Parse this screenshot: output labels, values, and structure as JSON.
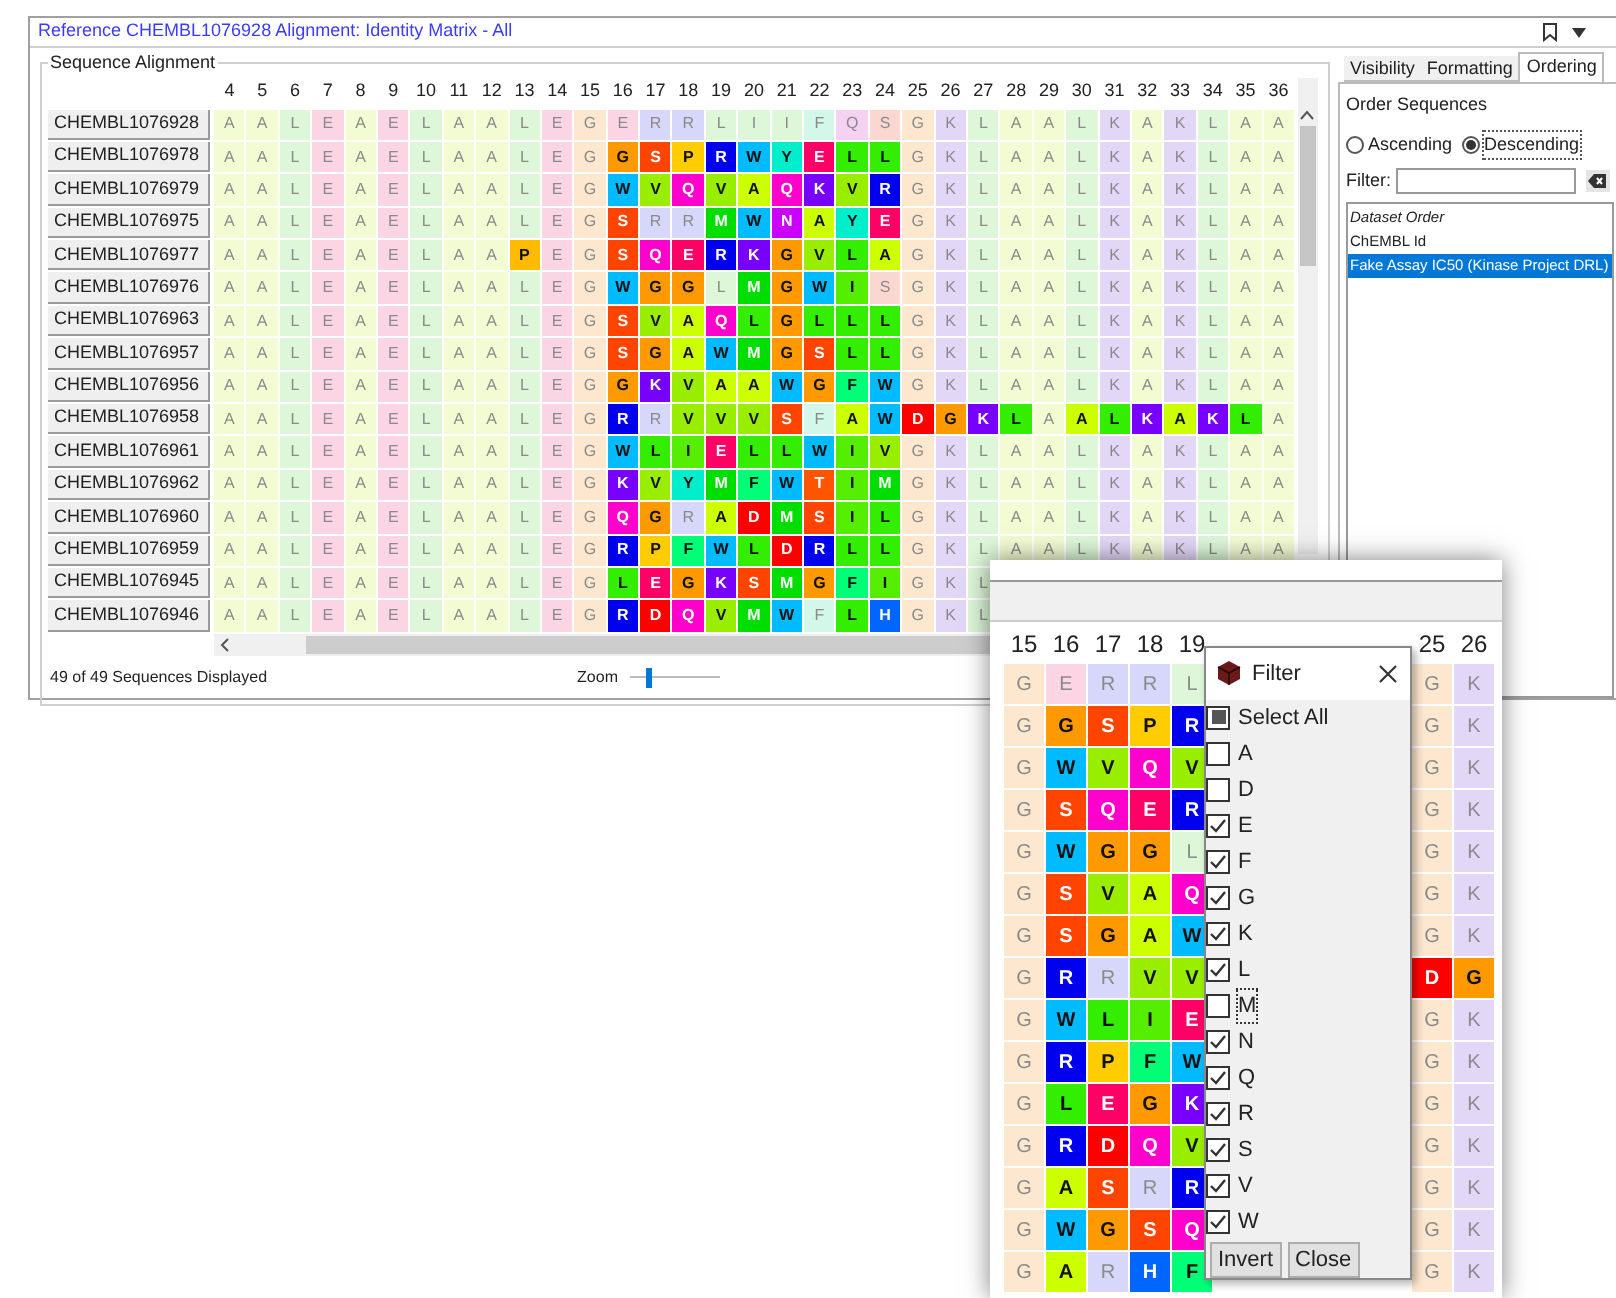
{
  "window": {
    "title": "Reference CHEMBL1076928 Alignment: Identity Matrix - All"
  },
  "alignment": {
    "title": "Sequence Alignment",
    "columns": [
      {
        "label": "4",
        "color": "#f3fbd3"
      },
      {
        "label": "5",
        "color": "#f3fbd3"
      },
      {
        "label": "6",
        "color": "#ddf7d8"
      },
      {
        "label": "7",
        "color": "#fbd5e3"
      },
      {
        "label": "8",
        "color": "#f3fbd3"
      },
      {
        "label": "9",
        "color": "#fbd5e3"
      },
      {
        "label": "10",
        "color": "#ddf7d8"
      },
      {
        "label": "11",
        "color": "#f3fbd3"
      },
      {
        "label": "12",
        "color": "#f3fbd3"
      },
      {
        "label": "13",
        "color": "#ddf7d8"
      },
      {
        "label": "14",
        "color": "#fbd5e3"
      },
      {
        "label": "15",
        "color": "#fde7cf"
      },
      {
        "label": "16",
        "color": "#fbd5e3"
      },
      {
        "label": "17",
        "color": "#d7d7fb"
      },
      {
        "label": "18",
        "color": "#d7d7fb"
      },
      {
        "label": "19",
        "color": "#ddf7d8"
      },
      {
        "label": "20",
        "color": "#ddf7d8"
      },
      {
        "label": "21",
        "color": "#ddf7d8"
      },
      {
        "label": "22",
        "color": "#d3f7e8"
      },
      {
        "label": "23",
        "color": "#f6d2f2"
      },
      {
        "label": "24",
        "color": "#fbd7d2"
      },
      {
        "label": "25",
        "color": "#fde7cf"
      },
      {
        "label": "26",
        "color": "#e3d7f8"
      },
      {
        "label": "27",
        "color": "#ddf7d8"
      },
      {
        "label": "28",
        "color": "#f3fbd3"
      },
      {
        "label": "29",
        "color": "#f3fbd3"
      },
      {
        "label": "30",
        "color": "#ddf7d8"
      },
      {
        "label": "31",
        "color": "#e3d7f8"
      },
      {
        "label": "32",
        "color": "#f3fbd3"
      },
      {
        "label": "33",
        "color": "#e3d7f8"
      },
      {
        "label": "34",
        "color": "#ddf7d8"
      },
      {
        "label": "35",
        "color": "#f3fbd3"
      },
      {
        "label": "36",
        "color": "#f3fbd3"
      }
    ],
    "rows": [
      {
        "name": "CHEMBL1076928",
        "cells": [
          "A",
          "A",
          "L",
          "E",
          "A",
          "E",
          "L",
          "A",
          "A",
          "L",
          "E",
          "G",
          "E",
          "R",
          "R",
          "L",
          "I",
          "I",
          "F",
          "Q",
          "S",
          "G",
          "K",
          "L",
          "A",
          "A",
          "L",
          "K",
          "A",
          "K",
          "L",
          "A",
          "A"
        ]
      },
      {
        "name": "CHEMBL1076978",
        "cells": [
          "A",
          "A",
          "L",
          "E",
          "A",
          "E",
          "L",
          "A",
          "A",
          "L",
          "E",
          "G",
          {
            "aa": "G",
            "color": "#ff9900"
          },
          {
            "aa": "S",
            "color": "#ff4400"
          },
          {
            "aa": "P",
            "color": "#ffcc00"
          },
          {
            "aa": "R",
            "color": "#0000ee"
          },
          {
            "aa": "W",
            "color": "#00bbff"
          },
          {
            "aa": "Y",
            "color": "#00eecc"
          },
          {
            "aa": "E",
            "color": "#ff0066"
          },
          {
            "aa": "L",
            "color": "#33ee00"
          },
          {
            "aa": "L",
            "color": "#33ee00"
          },
          "G",
          "K",
          "L",
          "A",
          "A",
          "L",
          "K",
          "A",
          "K",
          "L",
          "A",
          "A"
        ]
      },
      {
        "name": "CHEMBL1076979",
        "cells": [
          "A",
          "A",
          "L",
          "E",
          "A",
          "E",
          "L",
          "A",
          "A",
          "L",
          "E",
          "G",
          {
            "aa": "W",
            "color": "#00bbff"
          },
          {
            "aa": "V",
            "color": "#99ee00"
          },
          {
            "aa": "Q",
            "color": "#ff00cc"
          },
          {
            "aa": "V",
            "color": "#99ee00"
          },
          {
            "aa": "A",
            "color": "#ccff00"
          },
          {
            "aa": "Q",
            "color": "#ff00cc"
          },
          {
            "aa": "K",
            "color": "#7700ff"
          },
          {
            "aa": "V",
            "color": "#99ee00"
          },
          {
            "aa": "R",
            "color": "#0000ee"
          },
          "G",
          "K",
          "L",
          "A",
          "A",
          "L",
          "K",
          "A",
          "K",
          "L",
          "A",
          "A"
        ]
      },
      {
        "name": "CHEMBL1076975",
        "cells": [
          "A",
          "A",
          "L",
          "E",
          "A",
          "E",
          "L",
          "A",
          "A",
          "L",
          "E",
          "G",
          {
            "aa": "S",
            "color": "#ff4400"
          },
          "R",
          "R",
          {
            "aa": "M",
            "color": "#00dd00"
          },
          {
            "aa": "W",
            "color": "#00bbff"
          },
          {
            "aa": "N",
            "color": "#cc00ff"
          },
          {
            "aa": "A",
            "color": "#ccff00"
          },
          {
            "aa": "Y",
            "color": "#00eecc"
          },
          {
            "aa": "E",
            "color": "#ff0066"
          },
          "G",
          "K",
          "L",
          "A",
          "A",
          "L",
          "K",
          "A",
          "K",
          "L",
          "A",
          "A"
        ]
      },
      {
        "name": "CHEMBL1076977",
        "cells": [
          "A",
          "A",
          "L",
          "E",
          "A",
          "E",
          "L",
          "A",
          "A",
          {
            "aa": "P",
            "color": "#ffbb00"
          },
          "E",
          "G",
          {
            "aa": "S",
            "color": "#ff4400"
          },
          {
            "aa": "Q",
            "color": "#ff00cc"
          },
          {
            "aa": "E",
            "color": "#ff0066"
          },
          {
            "aa": "R",
            "color": "#0000ee"
          },
          {
            "aa": "K",
            "color": "#7700ff"
          },
          {
            "aa": "G",
            "color": "#ff9900"
          },
          {
            "aa": "V",
            "color": "#99ee00"
          },
          {
            "aa": "L",
            "color": "#33ee00"
          },
          {
            "aa": "A",
            "color": "#ccff00"
          },
          "G",
          "K",
          "L",
          "A",
          "A",
          "L",
          "K",
          "A",
          "K",
          "L",
          "A",
          "A"
        ]
      },
      {
        "name": "CHEMBL1076976",
        "cells": [
          "A",
          "A",
          "L",
          "E",
          "A",
          "E",
          "L",
          "A",
          "A",
          "L",
          "E",
          "G",
          {
            "aa": "W",
            "color": "#00bbff"
          },
          {
            "aa": "G",
            "color": "#ff9900"
          },
          {
            "aa": "G",
            "color": "#ff9900"
          },
          "L",
          {
            "aa": "M",
            "color": "#00dd00"
          },
          {
            "aa": "G",
            "color": "#ff9900"
          },
          {
            "aa": "W",
            "color": "#00bbff"
          },
          {
            "aa": "I",
            "color": "#55ee00"
          },
          "S",
          "G",
          "K",
          "L",
          "A",
          "A",
          "L",
          "K",
          "A",
          "K",
          "L",
          "A",
          "A"
        ]
      },
      {
        "name": "CHEMBL1076963",
        "cells": [
          "A",
          "A",
          "L",
          "E",
          "A",
          "E",
          "L",
          "A",
          "A",
          "L",
          "E",
          "G",
          {
            "aa": "S",
            "color": "#ff4400"
          },
          {
            "aa": "V",
            "color": "#99ee00"
          },
          {
            "aa": "A",
            "color": "#ccff00"
          },
          {
            "aa": "Q",
            "color": "#ff00cc"
          },
          {
            "aa": "L",
            "color": "#33ee00"
          },
          {
            "aa": "G",
            "color": "#ff9900"
          },
          {
            "aa": "L",
            "color": "#33ee00"
          },
          {
            "aa": "L",
            "color": "#33ee00"
          },
          {
            "aa": "L",
            "color": "#33ee00"
          },
          "G",
          "K",
          "L",
          "A",
          "A",
          "L",
          "K",
          "A",
          "K",
          "L",
          "A",
          "A"
        ]
      },
      {
        "name": "CHEMBL1076957",
        "cells": [
          "A",
          "A",
          "L",
          "E",
          "A",
          "E",
          "L",
          "A",
          "A",
          "L",
          "E",
          "G",
          {
            "aa": "S",
            "color": "#ff4400"
          },
          {
            "aa": "G",
            "color": "#ff9900"
          },
          {
            "aa": "A",
            "color": "#ccff00"
          },
          {
            "aa": "W",
            "color": "#00bbff"
          },
          {
            "aa": "M",
            "color": "#00dd00"
          },
          {
            "aa": "G",
            "color": "#ff9900"
          },
          {
            "aa": "S",
            "color": "#ff4400"
          },
          {
            "aa": "L",
            "color": "#33ee00"
          },
          {
            "aa": "L",
            "color": "#33ee00"
          },
          "G",
          "K",
          "L",
          "A",
          "A",
          "L",
          "K",
          "A",
          "K",
          "L",
          "A",
          "A"
        ]
      },
      {
        "name": "CHEMBL1076956",
        "cells": [
          "A",
          "A",
          "L",
          "E",
          "A",
          "E",
          "L",
          "A",
          "A",
          "L",
          "E",
          "G",
          {
            "aa": "G",
            "color": "#ff9900"
          },
          {
            "aa": "K",
            "color": "#7700ff"
          },
          {
            "aa": "V",
            "color": "#99ee00"
          },
          {
            "aa": "A",
            "color": "#ccff00"
          },
          {
            "aa": "A",
            "color": "#ccff00"
          },
          {
            "aa": "W",
            "color": "#00bbff"
          },
          {
            "aa": "G",
            "color": "#ff9900"
          },
          {
            "aa": "F",
            "color": "#00ff77"
          },
          {
            "aa": "W",
            "color": "#00bbff"
          },
          "G",
          "K",
          "L",
          "A",
          "A",
          "L",
          "K",
          "A",
          "K",
          "L",
          "A",
          "A"
        ]
      },
      {
        "name": "CHEMBL1076958",
        "cells": [
          "A",
          "A",
          "L",
          "E",
          "A",
          "E",
          "L",
          "A",
          "A",
          "L",
          "E",
          "G",
          {
            "aa": "R",
            "color": "#0000ee"
          },
          "R",
          {
            "aa": "V",
            "color": "#99ee00"
          },
          {
            "aa": "V",
            "color": "#99ee00"
          },
          {
            "aa": "V",
            "color": "#99ee00"
          },
          {
            "aa": "S",
            "color": "#ff4400"
          },
          "F",
          {
            "aa": "A",
            "color": "#ccff00"
          },
          {
            "aa": "W",
            "color": "#00bbff"
          },
          {
            "aa": "D",
            "color": "#ff0000"
          },
          {
            "aa": "G",
            "color": "#ff9900"
          },
          {
            "aa": "K",
            "color": "#7700ff"
          },
          {
            "aa": "L",
            "color": "#33ee00"
          },
          "A",
          {
            "aa": "A",
            "color": "#ccff00"
          },
          {
            "aa": "L",
            "color": "#33ee00"
          },
          {
            "aa": "K",
            "color": "#7700ff"
          },
          {
            "aa": "A",
            "color": "#ccff00"
          },
          {
            "aa": "K",
            "color": "#7700ff"
          },
          {
            "aa": "L",
            "color": "#33ee00"
          },
          "A"
        ]
      },
      {
        "name": "CHEMBL1076961",
        "cells": [
          "A",
          "A",
          "L",
          "E",
          "A",
          "E",
          "L",
          "A",
          "A",
          "L",
          "E",
          "G",
          {
            "aa": "W",
            "color": "#00bbff"
          },
          {
            "aa": "L",
            "color": "#33ee00"
          },
          {
            "aa": "I",
            "color": "#55ee00"
          },
          {
            "aa": "E",
            "color": "#ff0066"
          },
          {
            "aa": "L",
            "color": "#33ee00"
          },
          {
            "aa": "L",
            "color": "#33ee00"
          },
          {
            "aa": "W",
            "color": "#00bbff"
          },
          {
            "aa": "I",
            "color": "#55ee00"
          },
          {
            "aa": "V",
            "color": "#99ee00"
          },
          "G",
          "K",
          "L",
          "A",
          "A",
          "L",
          "K",
          "A",
          "K",
          "L",
          "A",
          "A"
        ]
      },
      {
        "name": "CHEMBL1076962",
        "cells": [
          "A",
          "A",
          "L",
          "E",
          "A",
          "E",
          "L",
          "A",
          "A",
          "L",
          "E",
          "G",
          {
            "aa": "K",
            "color": "#7700ff"
          },
          {
            "aa": "V",
            "color": "#99ee00"
          },
          {
            "aa": "Y",
            "color": "#00eecc"
          },
          {
            "aa": "M",
            "color": "#00dd00"
          },
          {
            "aa": "F",
            "color": "#00ff77"
          },
          {
            "aa": "W",
            "color": "#00bbff"
          },
          {
            "aa": "T",
            "color": "#ff5500"
          },
          {
            "aa": "I",
            "color": "#55ee00"
          },
          {
            "aa": "M",
            "color": "#00dd00"
          },
          "G",
          "K",
          "L",
          "A",
          "A",
          "L",
          "K",
          "A",
          "K",
          "L",
          "A",
          "A"
        ]
      },
      {
        "name": "CHEMBL1076960",
        "cells": [
          "A",
          "A",
          "L",
          "E",
          "A",
          "E",
          "L",
          "A",
          "A",
          "L",
          "E",
          "G",
          {
            "aa": "Q",
            "color": "#ff00cc"
          },
          {
            "aa": "G",
            "color": "#ff9900"
          },
          "R",
          {
            "aa": "A",
            "color": "#ccff00"
          },
          {
            "aa": "D",
            "color": "#ff0000"
          },
          {
            "aa": "M",
            "color": "#00dd00"
          },
          {
            "aa": "S",
            "color": "#ff4400"
          },
          {
            "aa": "I",
            "color": "#55ee00"
          },
          {
            "aa": "L",
            "color": "#33ee00"
          },
          "G",
          "K",
          "L",
          "A",
          "A",
          "L",
          "K",
          "A",
          "K",
          "L",
          "A",
          "A"
        ]
      },
      {
        "name": "CHEMBL1076959",
        "cells": [
          "A",
          "A",
          "L",
          "E",
          "A",
          "E",
          "L",
          "A",
          "A",
          "L",
          "E",
          "G",
          {
            "aa": "R",
            "color": "#0000ee"
          },
          {
            "aa": "P",
            "color": "#ffcc00"
          },
          {
            "aa": "F",
            "color": "#00ff77"
          },
          {
            "aa": "W",
            "color": "#00bbff"
          },
          {
            "aa": "L",
            "color": "#33ee00"
          },
          {
            "aa": "D",
            "color": "#ff0000"
          },
          {
            "aa": "R",
            "color": "#0000ee"
          },
          {
            "aa": "L",
            "color": "#33ee00"
          },
          {
            "aa": "L",
            "color": "#33ee00"
          },
          "G",
          "K",
          "L",
          "A",
          "A",
          "L",
          "K",
          "A",
          "K",
          "L",
          "A",
          "A"
        ]
      },
      {
        "name": "CHEMBL1076945",
        "cells": [
          "A",
          "A",
          "L",
          "E",
          "A",
          "E",
          "L",
          "A",
          "A",
          "L",
          "E",
          "G",
          {
            "aa": "L",
            "color": "#33ee00"
          },
          {
            "aa": "E",
            "color": "#ff0066"
          },
          {
            "aa": "G",
            "color": "#ff9900"
          },
          {
            "aa": "K",
            "color": "#7700ff"
          },
          {
            "aa": "S",
            "color": "#ff4400"
          },
          {
            "aa": "M",
            "color": "#00dd00"
          },
          {
            "aa": "G",
            "color": "#ff9900"
          },
          {
            "aa": "F",
            "color": "#00ff77"
          },
          {
            "aa": "I",
            "color": "#55ee00"
          },
          "G",
          "K",
          "L"
        ]
      },
      {
        "name": "CHEMBL1076946",
        "cells": [
          "A",
          "A",
          "L",
          "E",
          "A",
          "E",
          "L",
          "A",
          "A",
          "L",
          "E",
          "G",
          {
            "aa": "R",
            "color": "#0000ee"
          },
          {
            "aa": "D",
            "color": "#ff0000"
          },
          {
            "aa": "Q",
            "color": "#ff00cc"
          },
          {
            "aa": "V",
            "color": "#99ee00"
          },
          {
            "aa": "M",
            "color": "#00dd00"
          },
          {
            "aa": "W",
            "color": "#00bbff"
          },
          "F",
          {
            "aa": "L",
            "color": "#33ee00"
          },
          {
            "aa": "H",
            "color": "#0066ff"
          },
          "G",
          "K",
          "L"
        ]
      }
    ],
    "status": "49 of 49 Sequences Displayed",
    "zoom": {
      "label": "Zoom",
      "level": 0.18
    }
  },
  "panel": {
    "tabs": [
      {
        "label": "Visibility",
        "selected": false
      },
      {
        "label": "Formatting",
        "selected": false
      },
      {
        "label": "Ordering",
        "selected": true
      }
    ],
    "heading": "Order Sequences",
    "order": [
      {
        "label": "Ascending",
        "selected": false
      },
      {
        "label": "Descending",
        "selected": true
      }
    ],
    "filter_label": "Filter:",
    "list": [
      {
        "label": "Dataset Order",
        "kind": "header",
        "selected": false
      },
      {
        "label": "ChEMBL Id",
        "kind": "option",
        "selected": false
      },
      {
        "label": "Fake Assay IC50 (Kinase Project DRL)",
        "kind": "option",
        "selected": true
      }
    ]
  },
  "overlay": {
    "left": {
      "columns": [
        {
          "label": "15",
          "color": "#fde7cf"
        },
        {
          "label": "16",
          "color": "#fbd5e3"
        },
        {
          "label": "17",
          "color": "#d7d7fb"
        },
        {
          "label": "18",
          "color": "#d7d7fb"
        },
        {
          "label": "19",
          "color": "#ddf7d8"
        }
      ],
      "rows": [
        {
          "cells": [
            "G",
            "E",
            "R",
            "R",
            "L"
          ]
        },
        {
          "cells": [
            "G",
            {
              "aa": "G",
              "color": "#ff9900"
            },
            {
              "aa": "S",
              "color": "#ff4400"
            },
            {
              "aa": "P",
              "color": "#ffcc00"
            },
            {
              "aa": "R",
              "color": "#0000ee"
            }
          ]
        },
        {
          "cells": [
            "G",
            {
              "aa": "W",
              "color": "#00bbff"
            },
            {
              "aa": "V",
              "color": "#99ee00"
            },
            {
              "aa": "Q",
              "color": "#ff00cc"
            },
            {
              "aa": "V",
              "color": "#99ee00"
            }
          ]
        },
        {
          "cells": [
            "G",
            {
              "aa": "S",
              "color": "#ff4400"
            },
            {
              "aa": "Q",
              "color": "#ff00cc"
            },
            {
              "aa": "E",
              "color": "#ff0066"
            },
            {
              "aa": "R",
              "color": "#0000ee"
            }
          ]
        },
        {
          "cells": [
            "G",
            {
              "aa": "W",
              "color": "#00bbff"
            },
            {
              "aa": "G",
              "color": "#ff9900"
            },
            {
              "aa": "G",
              "color": "#ff9900"
            },
            "L"
          ]
        },
        {
          "cells": [
            "G",
            {
              "aa": "S",
              "color": "#ff4400"
            },
            {
              "aa": "V",
              "color": "#99ee00"
            },
            {
              "aa": "A",
              "color": "#ccff00"
            },
            {
              "aa": "Q",
              "color": "#ff00cc"
            }
          ]
        },
        {
          "cells": [
            "G",
            {
              "aa": "S",
              "color": "#ff4400"
            },
            {
              "aa": "G",
              "color": "#ff9900"
            },
            {
              "aa": "A",
              "color": "#ccff00"
            },
            {
              "aa": "W",
              "color": "#00bbff"
            }
          ]
        },
        {
          "cells": [
            "G",
            {
              "aa": "R",
              "color": "#0000ee"
            },
            "R",
            {
              "aa": "V",
              "color": "#99ee00"
            },
            {
              "aa": "V",
              "color": "#99ee00"
            }
          ]
        },
        {
          "cells": [
            "G",
            {
              "aa": "W",
              "color": "#00bbff"
            },
            {
              "aa": "L",
              "color": "#33ee00"
            },
            {
              "aa": "I",
              "color": "#55ee00"
            },
            {
              "aa": "E",
              "color": "#ff0066"
            }
          ]
        },
        {
          "cells": [
            "G",
            {
              "aa": "R",
              "color": "#0000ee"
            },
            {
              "aa": "P",
              "color": "#ffcc00"
            },
            {
              "aa": "F",
              "color": "#00ff77"
            },
            {
              "aa": "W",
              "color": "#00bbff"
            }
          ]
        },
        {
          "cells": [
            "G",
            {
              "aa": "L",
              "color": "#33ee00"
            },
            {
              "aa": "E",
              "color": "#ff0066"
            },
            {
              "aa": "G",
              "color": "#ff9900"
            },
            {
              "aa": "K",
              "color": "#7700ff"
            }
          ]
        },
        {
          "cells": [
            "G",
            {
              "aa": "R",
              "color": "#0000ee"
            },
            {
              "aa": "D",
              "color": "#ff0000"
            },
            {
              "aa": "Q",
              "color": "#ff00cc"
            },
            {
              "aa": "V",
              "color": "#99ee00"
            }
          ]
        },
        {
          "cells": [
            "G",
            {
              "aa": "A",
              "color": "#ccff00"
            },
            {
              "aa": "S",
              "color": "#ff4400"
            },
            "R",
            {
              "aa": "R",
              "color": "#0000ee"
            }
          ]
        },
        {
          "cells": [
            "G",
            {
              "aa": "W",
              "color": "#00bbff"
            },
            {
              "aa": "G",
              "color": "#ff9900"
            },
            {
              "aa": "S",
              "color": "#ff4400"
            },
            {
              "aa": "Q",
              "color": "#ff00cc"
            }
          ]
        },
        {
          "cells": [
            "G",
            {
              "aa": "A",
              "color": "#ccff00"
            },
            "R",
            {
              "aa": "H",
              "color": "#0066ff"
            },
            {
              "aa": "F",
              "color": "#00ff77"
            }
          ]
        }
      ]
    },
    "right": {
      "columns": [
        {
          "label": "25",
          "color": "#fde7cf"
        },
        {
          "label": "26",
          "color": "#e3d7f8"
        }
      ],
      "rows": [
        {
          "cells": [
            "G",
            "K"
          ]
        },
        {
          "cells": [
            "G",
            "K"
          ]
        },
        {
          "cells": [
            "G",
            "K"
          ]
        },
        {
          "cells": [
            "G",
            "K"
          ]
        },
        {
          "cells": [
            "G",
            "K"
          ]
        },
        {
          "cells": [
            "G",
            "K"
          ]
        },
        {
          "cells": [
            "G",
            "K"
          ]
        },
        {
          "cells": [
            {
              "aa": "D",
              "color": "#ff0000"
            },
            {
              "aa": "G",
              "color": "#ff9900"
            }
          ]
        },
        {
          "cells": [
            "G",
            "K"
          ]
        },
        {
          "cells": [
            "G",
            "K"
          ]
        },
        {
          "cells": [
            "G",
            "K"
          ]
        },
        {
          "cells": [
            "G",
            "K"
          ]
        },
        {
          "cells": [
            "G",
            "K"
          ]
        },
        {
          "cells": [
            "G",
            "K"
          ]
        },
        {
          "cells": [
            "G",
            "K"
          ]
        }
      ]
    },
    "filter": {
      "title": "Filter",
      "select_all": {
        "label": "Select All",
        "partial": true
      },
      "items": [
        {
          "label": "A",
          "checked": false,
          "focused": false
        },
        {
          "label": "D",
          "checked": false,
          "focused": false
        },
        {
          "label": "E",
          "checked": true,
          "focused": false
        },
        {
          "label": "F",
          "checked": true,
          "focused": false
        },
        {
          "label": "G",
          "checked": true,
          "focused": false
        },
        {
          "label": "K",
          "checked": true,
          "focused": false
        },
        {
          "label": "L",
          "checked": true,
          "focused": false
        },
        {
          "label": "M",
          "checked": false,
          "focused": true
        },
        {
          "label": "N",
          "checked": true,
          "focused": false
        },
        {
          "label": "Q",
          "checked": true,
          "focused": false
        },
        {
          "label": "R",
          "checked": true,
          "focused": false
        },
        {
          "label": "S",
          "checked": true,
          "focused": false
        },
        {
          "label": "V",
          "checked": true,
          "focused": false
        },
        {
          "label": "W",
          "checked": true,
          "focused": false
        }
      ],
      "buttons": [
        "Invert",
        "Close"
      ]
    }
  }
}
